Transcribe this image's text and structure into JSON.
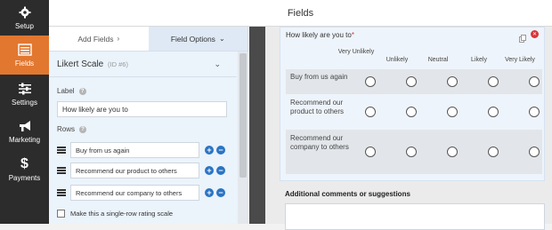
{
  "nav": [
    {
      "label": "Setup",
      "icon": "gear-icon"
    },
    {
      "label": "Fields",
      "icon": "list-icon",
      "active": true
    },
    {
      "label": "Settings",
      "icon": "sliders-icon"
    },
    {
      "label": "Marketing",
      "icon": "megaphone-icon"
    },
    {
      "label": "Payments",
      "icon": "dollar-icon"
    }
  ],
  "header": {
    "title": "Fields"
  },
  "panel": {
    "tabs": {
      "add": "Add Fields",
      "options": "Field Options"
    },
    "field_name": "Likert Scale",
    "field_id": "(ID #6)",
    "label_title": "Label",
    "label_value": "How likely are you to",
    "rows_title": "Rows",
    "rows": [
      "Buy from us again",
      "Recommend our product to others",
      "Recommend our company to others"
    ],
    "single_row": "Make this a single-row rating scale"
  },
  "preview": {
    "question": "How likely are you to",
    "required_mark": "*",
    "columns": [
      "Very Unlikely",
      "Unlikely",
      "Neutral",
      "Likely",
      "Very Likely"
    ],
    "rows": [
      "Buy from us again",
      "Recommend our product to others",
      "Recommend our company to others"
    ],
    "comments_label": "Additional comments or suggestions"
  },
  "colors": {
    "accent": "#e27730",
    "nav_bg": "#2c2c2c",
    "blue": "#2a74c4",
    "red": "#d63638"
  }
}
